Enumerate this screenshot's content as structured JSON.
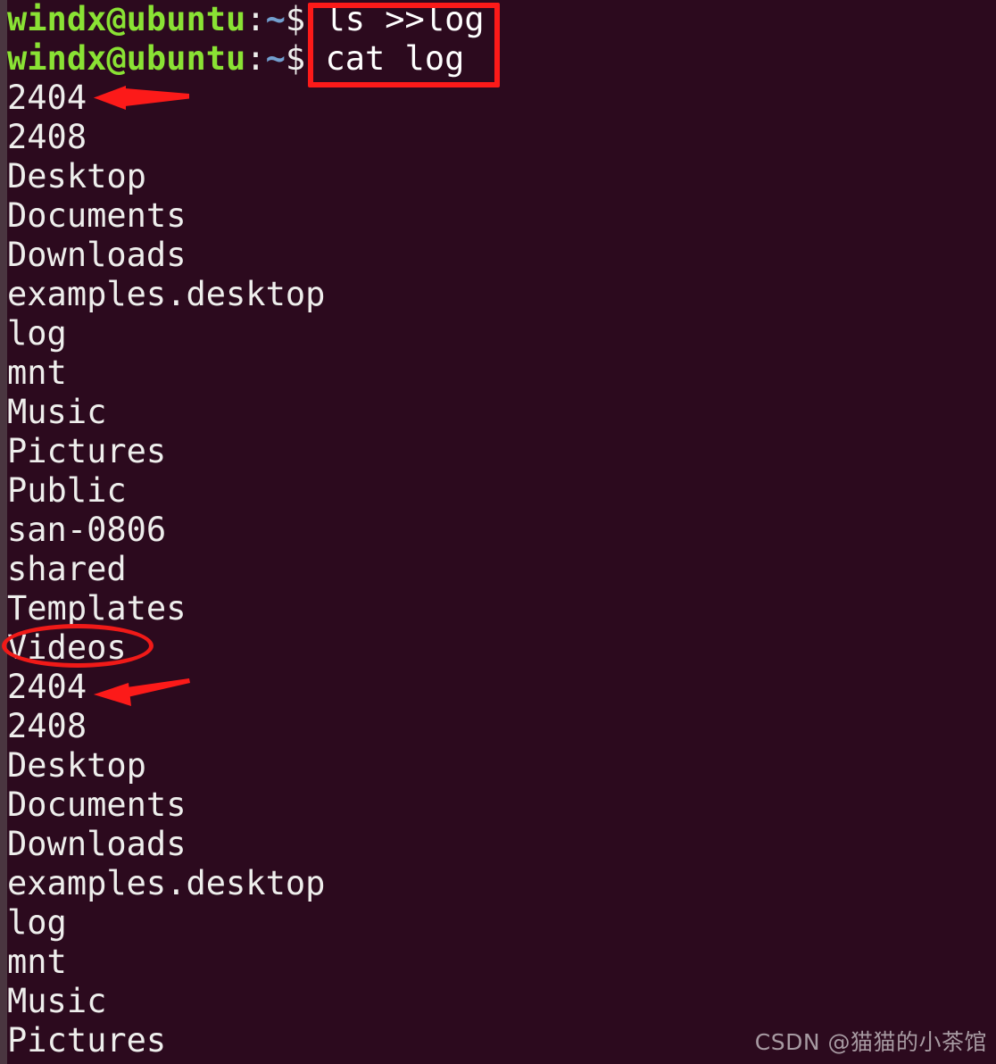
{
  "terminal": {
    "theme": {
      "background": "#2c0a1e",
      "foreground": "#eeeeec",
      "prompt_user_host_color": "#8ae234",
      "prompt_path_color": "#729fcf",
      "border_strip_color": "#4a3640"
    },
    "prompt": {
      "user_host": "windx@ubuntu",
      "colon": ":",
      "path": "~",
      "sigil": "$"
    },
    "commands": [
      {
        "text": "ls >>log"
      },
      {
        "text": "cat log"
      }
    ],
    "output_lines": [
      "2404",
      "2408",
      "Desktop",
      "Documents",
      "Downloads",
      "examples.desktop",
      "log",
      "mnt",
      "Music",
      "Pictures",
      "Public",
      "san-0806",
      "shared",
      "Templates",
      "Videos",
      "2404",
      "2408",
      "Desktop",
      "Documents",
      "Downloads",
      "examples.desktop",
      "log",
      "mnt",
      "Music",
      "Pictures"
    ]
  },
  "annotations": {
    "color": "#fc1a19",
    "command_box": {
      "label": "ls >>log / cat log highlight"
    },
    "ellipse": {
      "label": "Videos"
    },
    "arrows": [
      {
        "label": "first 2404 output"
      },
      {
        "label": "second 2404 output"
      }
    ]
  },
  "watermark": {
    "text": "CSDN @猫猫的小茶馆"
  }
}
